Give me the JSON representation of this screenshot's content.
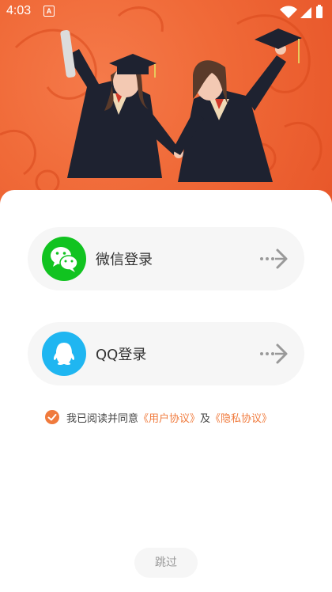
{
  "status_bar": {
    "time": "4:03",
    "notification_icon": "a-letter-icon",
    "indicators": [
      "wifi-icon",
      "cellular-signal-icon",
      "battery-icon"
    ]
  },
  "hero": {
    "illustration": "two graduates in caps and gowns holding hands on orange background"
  },
  "login_options": [
    {
      "id": "wechat",
      "label": "微信登录",
      "icon": "wechat-icon",
      "color": "#11c320"
    },
    {
      "id": "qq",
      "label": "QQ登录",
      "icon": "qq-icon",
      "color": "#1fb6f1"
    }
  ],
  "agreement": {
    "checked": true,
    "prefix": "我已阅读并同意",
    "user_agreement": "《用户协议》",
    "conjunction": "及",
    "privacy_policy": "《隐私协议》",
    "accent_color": "#f07a3c"
  },
  "skip_label": "跳过"
}
